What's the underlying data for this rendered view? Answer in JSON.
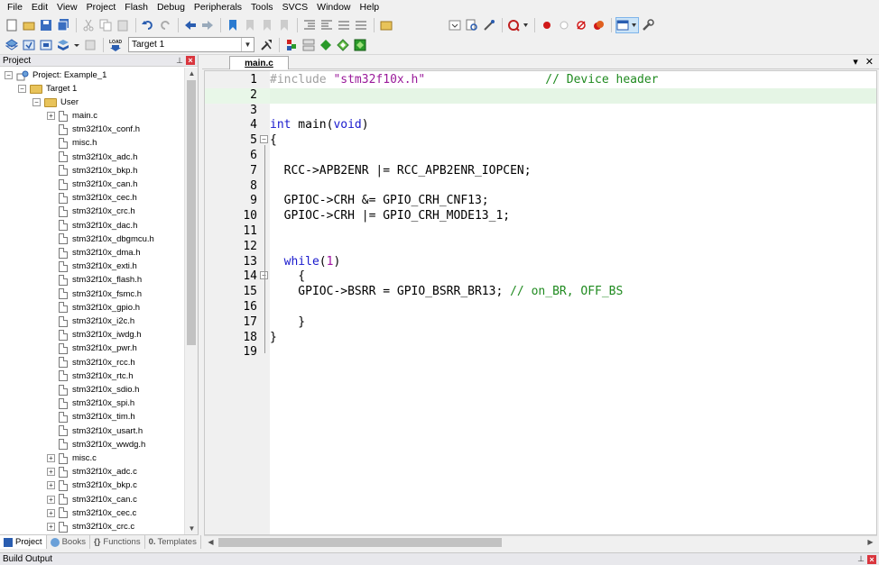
{
  "menu": [
    "File",
    "Edit",
    "View",
    "Project",
    "Flash",
    "Debug",
    "Peripherals",
    "Tools",
    "SVCS",
    "Window",
    "Help"
  ],
  "toolbar": {
    "target": "Target 1",
    "load_label": "LOAD"
  },
  "project_panel": {
    "title": "Project",
    "project": "Project: Example_1",
    "target": "Target 1",
    "group": "User",
    "files": [
      "main.c",
      "stm32f10x_conf.h",
      "misc.h",
      "stm32f10x_adc.h",
      "stm32f10x_bkp.h",
      "stm32f10x_can.h",
      "stm32f10x_cec.h",
      "stm32f10x_crc.h",
      "stm32f10x_dac.h",
      "stm32f10x_dbgmcu.h",
      "stm32f10x_dma.h",
      "stm32f10x_exti.h",
      "stm32f10x_flash.h",
      "stm32f10x_fsmc.h",
      "stm32f10x_gpio.h",
      "stm32f10x_i2c.h",
      "stm32f10x_iwdg.h",
      "stm32f10x_pwr.h",
      "stm32f10x_rcc.h",
      "stm32f10x_rtc.h",
      "stm32f10x_sdio.h",
      "stm32f10x_spi.h",
      "stm32f10x_tim.h",
      "stm32f10x_usart.h",
      "stm32f10x_wwdg.h",
      "misc.c",
      "stm32f10x_adc.c",
      "stm32f10x_bkp.c",
      "stm32f10x_can.c",
      "stm32f10x_cec.c",
      "stm32f10x_crc.c"
    ],
    "tabs": [
      "Project",
      "Books",
      "Functions",
      "Templates"
    ]
  },
  "editor": {
    "tab": "main.c",
    "lines": [
      "#include \"stm32f10x.h\"                 // Device header",
      "",
      "",
      "int main(void)",
      "{",
      "",
      "  RCC->APB2ENR |= RCC_APB2ENR_IOPCEN;",
      "",
      "  GPIOC->CRH &= GPIO_CRH_CNF13;",
      "  GPIOC->CRH |= GPIO_CRH_MODE13_1;",
      "",
      "",
      "  while(1)",
      "    {",
      "    GPIOC->BSRR = GPIO_BSRR_BR13; // on_BR, OFF_BS",
      "",
      "    }",
      "}",
      ""
    ]
  },
  "build_output": {
    "title": "Build Output"
  }
}
